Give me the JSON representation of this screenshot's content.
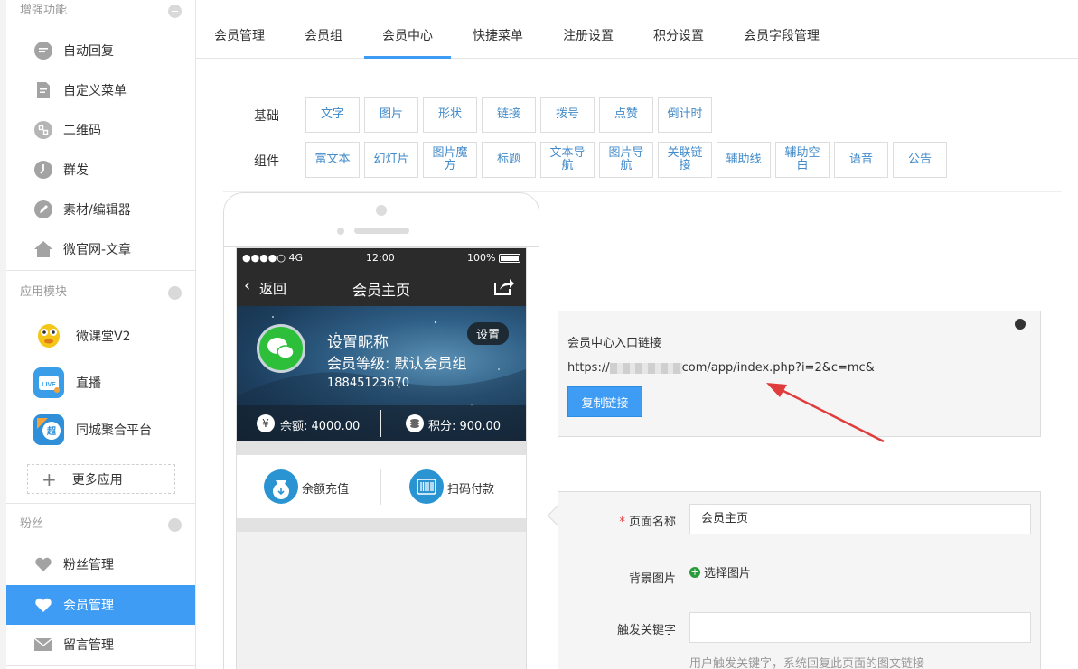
{
  "sidebar": {
    "sections": {
      "enhance": "增强功能",
      "apps": "应用模块",
      "fans": "粉丝"
    },
    "enhance_items": [
      {
        "label": "自动回复",
        "icon": "chat-bubble-icon"
      },
      {
        "label": "自定义菜单",
        "icon": "document-icon"
      },
      {
        "label": "二维码",
        "icon": "qrcode-icon"
      },
      {
        "label": "群发",
        "icon": "clock-icon"
      },
      {
        "label": "素材/编辑器",
        "icon": "pencil-icon"
      },
      {
        "label": "微官网-文章",
        "icon": "house-icon"
      }
    ],
    "app_items": [
      {
        "label": "微课堂V2",
        "icon": "cartoon-app-icon"
      },
      {
        "label": "直播",
        "icon": "live-tv-icon"
      },
      {
        "label": "同城聚合平台",
        "icon": "super-city-icon"
      }
    ],
    "more_apps": "更多应用",
    "fans_items": [
      {
        "label": "粉丝管理",
        "icon": "heart-icon"
      },
      {
        "label": "会员管理",
        "icon": "heart-icon"
      },
      {
        "label": "留言管理",
        "icon": "envelope-icon"
      }
    ]
  },
  "tabs": [
    "会员管理",
    "会员组",
    "会员中心",
    "快捷菜单",
    "注册设置",
    "积分设置",
    "会员字段管理"
  ],
  "components": {
    "basic_label": "基础",
    "basic": [
      "文字",
      "图片",
      "形状",
      "链接",
      "拨号",
      "点赞",
      "倒计时"
    ],
    "widget_label": "组件",
    "widgets": [
      "富文本",
      "幻灯片",
      "图片魔方",
      "标题",
      "文本导航",
      "图片导航",
      "关联链接",
      "辅助线",
      "辅助空白",
      "语音",
      "公告"
    ]
  },
  "phone": {
    "status": {
      "signal": "●●●●○ 4G",
      "time": "12:00",
      "battery": "100%"
    },
    "nav": {
      "back": "返回",
      "title": "会员主页"
    },
    "profile": {
      "nickname": "设置昵称",
      "level": "会员等级: 默认会员组",
      "phone": "18845123670",
      "settings": "设置",
      "balance": "余额: 4000.00",
      "points": "积分: 900.00"
    },
    "actions": {
      "recharge": "余额充值",
      "scanpay": "扫码付款"
    }
  },
  "link_panel": {
    "title": "会员中心入口链接",
    "url_prefix": "https://",
    "url_suffix": "com/app/index.php?i=2&c=mc&",
    "copy_button": "复制链接"
  },
  "form": {
    "page_name_label": "页面名称",
    "page_name_value": "会员主页",
    "bg_label": "背景图片",
    "bg_button": "选择图片",
    "keyword_label": "触发关键字",
    "keyword_value": "",
    "keyword_help": "用户触发关键字，系统回复此页面的图文链接"
  },
  "colors": {
    "accent": "#3e9cf4",
    "link": "#428bca",
    "annotation_arrow": "#e03c3c"
  }
}
